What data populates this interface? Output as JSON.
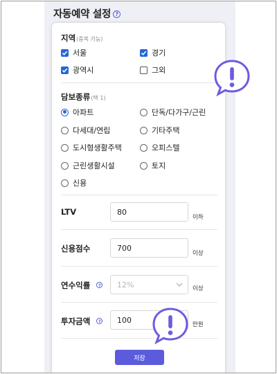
{
  "page": {
    "title": "자동예약 설정"
  },
  "region": {
    "label": "지역",
    "hint": "(중복 가능)",
    "options": [
      {
        "label": "서울",
        "checked": true
      },
      {
        "label": "경기",
        "checked": true
      },
      {
        "label": "광역시",
        "checked": true
      },
      {
        "label": "그외",
        "checked": false
      }
    ]
  },
  "collateral": {
    "label": "담보종류",
    "hint": "(택 1)",
    "options": [
      {
        "label": "아파트",
        "selected": true
      },
      {
        "label": "단독/다가구/근린",
        "selected": false
      },
      {
        "label": "다세대/연립",
        "selected": false
      },
      {
        "label": "기타주택",
        "selected": false
      },
      {
        "label": "도시형생활주택",
        "selected": false
      },
      {
        "label": "오피스텔",
        "selected": false
      },
      {
        "label": "근린생활시설",
        "selected": false
      },
      {
        "label": "토지",
        "selected": false
      },
      {
        "label": "신용",
        "selected": false
      }
    ]
  },
  "ltv": {
    "label": "LTV",
    "value": "80",
    "unit": "이하"
  },
  "credit_score": {
    "label": "신용점수",
    "value": "700",
    "unit": "이상"
  },
  "annual_yield": {
    "label": "연수익률",
    "placeholder": "12%",
    "unit": "이상"
  },
  "investment": {
    "label": "투자금액",
    "value": "100",
    "unit": "만원"
  },
  "actions": {
    "save_label": "저장"
  },
  "colors": {
    "accent": "#5b5cdc",
    "checkbox": "#2566d8",
    "alert": "#6b5ce0"
  },
  "icons": {
    "help": "question-circle-icon",
    "alert": "exclamation-speech-bubble-icon",
    "dropdown": "chevron-down-icon"
  }
}
